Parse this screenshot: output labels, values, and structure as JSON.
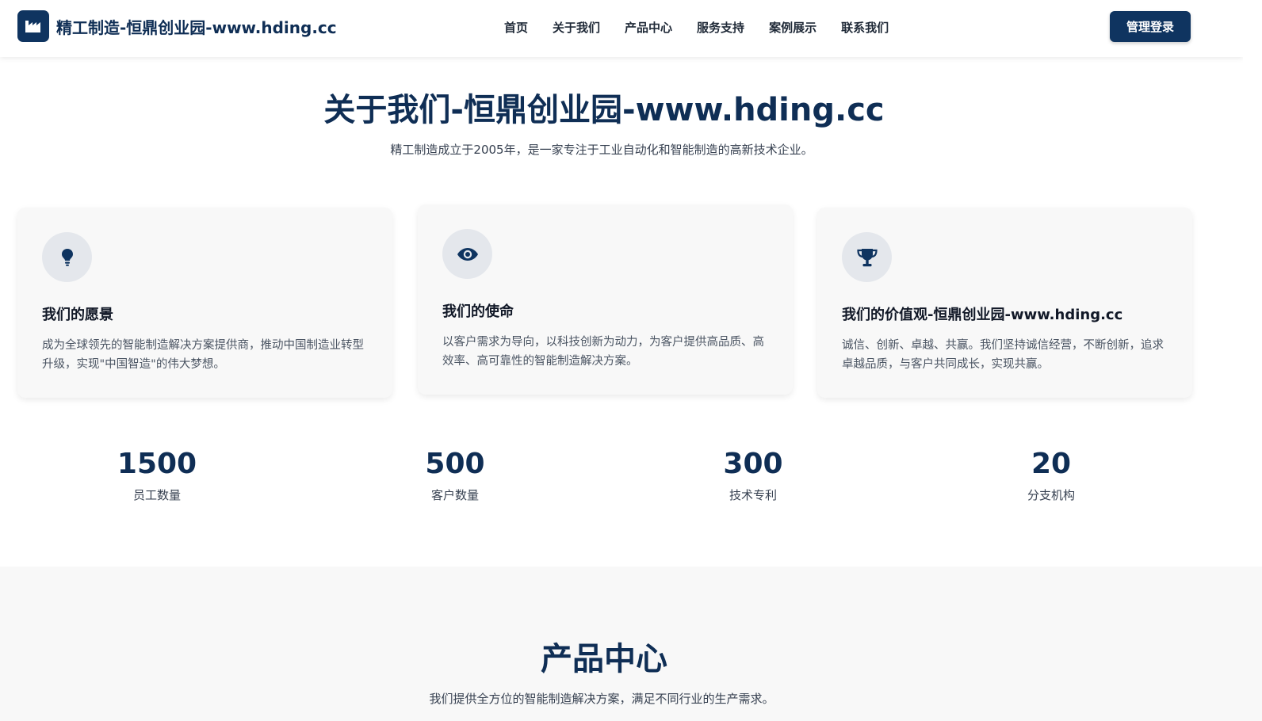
{
  "colors": {
    "primary": "#0f3460",
    "heading": "#0f2e55",
    "card_bg": "#f8f8f8",
    "icon_circle": "#e4e7ec"
  },
  "header": {
    "brand_icon": "factory-icon",
    "brand_name": "精工制造-恒鼎创业园-www.hding.cc",
    "nav": [
      "首页",
      "关于我们",
      "产品中心",
      "服务支持",
      "案例展示",
      "联系我们"
    ],
    "login_label": "管理登录"
  },
  "about": {
    "title": "关于我们-恒鼎创业园-www.hding.cc",
    "subtitle": "精工制造成立于2005年，是一家专注于工业自动化和智能制造的高新技术企业。",
    "cards": [
      {
        "icon": "lightbulb-icon",
        "title": "我们的愿景",
        "text": "成为全球领先的智能制造解决方案提供商，推动中国制造业转型升级，实现\"中国智造\"的伟大梦想。"
      },
      {
        "icon": "eye-icon",
        "title": "我们的使命",
        "text": "以客户需求为导向，以科技创新为动力，为客户提供高品质、高效率、高可靠性的智能制造解决方案。"
      },
      {
        "icon": "trophy-icon",
        "title": "我们的价值观-恒鼎创业园-www.hding.cc",
        "text": "诚信、创新、卓越、共赢。我们坚持诚信经营，不断创新，追求卓越品质，与客户共同成长，实现共赢。"
      }
    ],
    "stats": [
      {
        "value": "1500",
        "label": "员工数量"
      },
      {
        "value": "500",
        "label": "客户数量"
      },
      {
        "value": "300",
        "label": "技术专利"
      },
      {
        "value": "20",
        "label": "分支机构"
      }
    ]
  },
  "products": {
    "title": "产品中心",
    "subtitle": "我们提供全方位的智能制造解决方案，满足不同行业的生产需求。"
  }
}
